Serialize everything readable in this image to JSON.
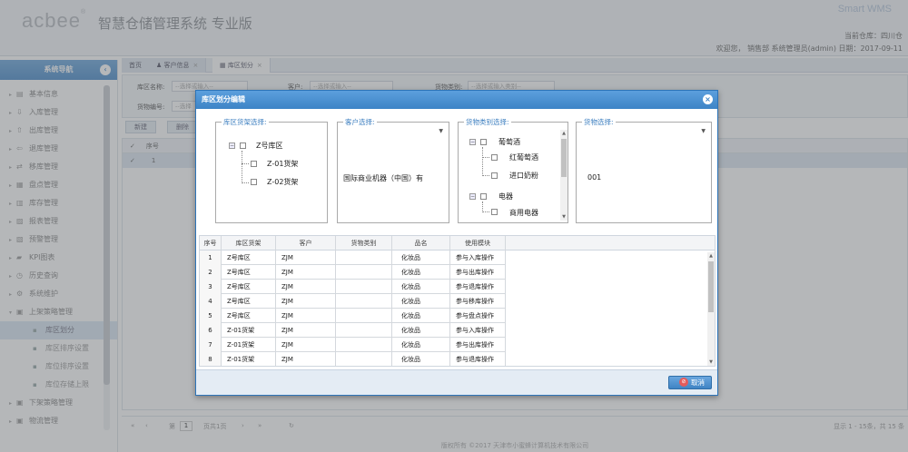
{
  "header": {
    "logo": "acbee",
    "title": "智慧仓储管理系统 专业版",
    "brand": "Smart WMS",
    "current_store": "当前仓库：四川仓",
    "welcome": "欢迎您， 销售部 系统管理员(admin) 日期：2017-09-11"
  },
  "sidebar": {
    "title": "系统导航",
    "collapse_icon": "chevron-left-icon",
    "items": [
      {
        "label": "基本信息",
        "icon": "info-icon"
      },
      {
        "label": "入库管理",
        "icon": "inbound-icon"
      },
      {
        "label": "出库管理",
        "icon": "outbound-icon"
      },
      {
        "label": "退库管理",
        "icon": "return-icon"
      },
      {
        "label": "移库管理",
        "icon": "move-icon"
      },
      {
        "label": "盘点管理",
        "icon": "inventory-icon"
      },
      {
        "label": "库存管理",
        "icon": "stock-icon"
      },
      {
        "label": "报表管理",
        "icon": "report-icon"
      },
      {
        "label": "预警管理",
        "icon": "warning-icon"
      },
      {
        "label": "KPI图表",
        "icon": "chart-icon"
      },
      {
        "label": "历史查询",
        "icon": "history-icon"
      },
      {
        "label": "系统维护",
        "icon": "gear-icon"
      },
      {
        "label": "上架策略管理",
        "icon": "shelf-icon"
      }
    ],
    "sub_items": [
      "库区划分",
      "库区排序设置",
      "库位排序设置",
      "库位存储上限"
    ],
    "items_after": [
      "下架策略管理",
      "物流管理"
    ]
  },
  "tabs": [
    {
      "label": "首页"
    },
    {
      "label": "客户信息"
    },
    {
      "label": "库区划分"
    }
  ],
  "filters": {
    "zone_label": "库区名称:",
    "zone_placeholder": "--选择或输入--",
    "customer_label": "客户:",
    "customer_placeholder": "--选择或输入--",
    "category_label": "货物类别:",
    "category_placeholder": "--选择或输入类别--",
    "goods_label": "货物编号:",
    "goods_placeholder": "--选择"
  },
  "toolbar": {
    "add_label": "新建",
    "delete_label": "删除"
  },
  "bg_grid": {
    "header_seq": "序号",
    "row1_seq": "1"
  },
  "pager": {
    "page_label": "第",
    "page_value": "1",
    "total_label": "页共1页",
    "summary": "显示 1 - 15条，共 15 条"
  },
  "footer": "版权所有 ©2017 天津市小蜜蜂计算机技术有限公司",
  "dialog": {
    "title": "库区划分编辑",
    "zone_legend": "库区货架选择:",
    "customer_legend": "客户选择:",
    "category_legend": "货物类别选择:",
    "goods_legend": "货物选择:",
    "zone_tree": {
      "root": "Z号库区",
      "children": [
        "Z-01货架",
        "Z-02货架"
      ]
    },
    "customer_value": "国际商业机器（中国）有",
    "category_tree": [
      {
        "label": "葡萄酒",
        "children": [
          "红葡萄酒",
          "进口奶粉"
        ]
      },
      {
        "label": "电器",
        "children": [
          "商用电器"
        ]
      }
    ],
    "goods_value": "001",
    "grid": {
      "columns": [
        "序号",
        "库区货架",
        "客户",
        "货物类别",
        "品名",
        "使用模块"
      ],
      "rows": [
        [
          "1",
          "Z号库区",
          "ZJM",
          "",
          "化妆品",
          "参与入库操作"
        ],
        [
          "2",
          "Z号库区",
          "ZJM",
          "",
          "化妆品",
          "参与出库操作"
        ],
        [
          "3",
          "Z号库区",
          "ZJM",
          "",
          "化妆品",
          "参与退库操作"
        ],
        [
          "4",
          "Z号库区",
          "ZJM",
          "",
          "化妆品",
          "参与移库操作"
        ],
        [
          "5",
          "Z号库区",
          "ZJM",
          "",
          "化妆品",
          "参与盘点操作"
        ],
        [
          "6",
          "Z-01货架",
          "ZJM",
          "",
          "化妆品",
          "参与入库操作"
        ],
        [
          "7",
          "Z-01货架",
          "ZJM",
          "",
          "化妆品",
          "参与出库操作"
        ],
        [
          "8",
          "Z-01货架",
          "ZJM",
          "",
          "化妆品",
          "参与退库操作"
        ]
      ]
    },
    "cancel_label": "取消"
  }
}
